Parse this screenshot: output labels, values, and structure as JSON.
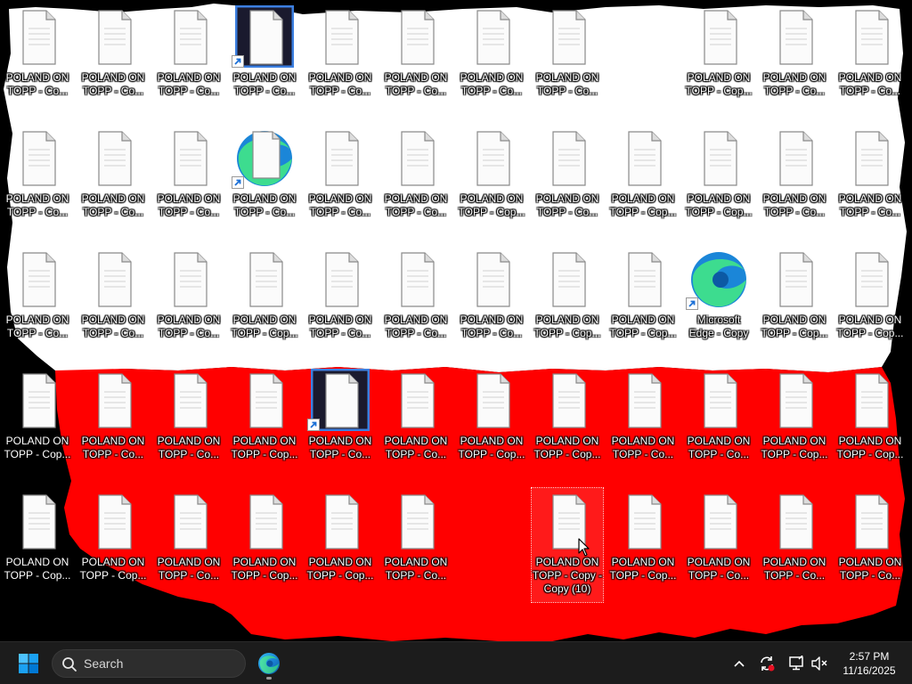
{
  "desktop": {
    "icons": [
      {
        "label": "POLAND ON TOPP - Co...",
        "kind": "file",
        "icon": "text-file-icon"
      },
      {
        "label": "POLAND ON TOPP - Co...",
        "kind": "file",
        "icon": "text-file-icon"
      },
      {
        "label": "POLAND ON TOPP - Co...",
        "kind": "file",
        "icon": "text-file-icon"
      },
      {
        "label": "POLAND ON TOPP - Co...",
        "kind": "shortcut-dark",
        "icon": "dark-file-shortcut-icon"
      },
      {
        "label": "POLAND ON TOPP - Co...",
        "kind": "file",
        "icon": "text-file-icon"
      },
      {
        "label": "POLAND ON TOPP - Co...",
        "kind": "file",
        "icon": "text-file-icon"
      },
      {
        "label": "POLAND ON TOPP - Co...",
        "kind": "file",
        "icon": "text-file-icon"
      },
      {
        "label": "POLAND ON TOPP - Co...",
        "kind": "file",
        "icon": "text-file-icon"
      },
      {
        "label": "",
        "kind": "empty",
        "icon": ""
      },
      {
        "label": "POLAND ON TOPP - Cop...",
        "kind": "file",
        "icon": "text-file-icon"
      },
      {
        "label": "POLAND ON TOPP - Co...",
        "kind": "file",
        "icon": "text-file-icon"
      },
      {
        "label": "POLAND ON TOPP - Co...",
        "kind": "file",
        "icon": "text-file-icon"
      },
      {
        "label": "POLAND ON TOPP - Co...",
        "kind": "file",
        "icon": "text-file-icon"
      },
      {
        "label": "POLAND ON TOPP - Co...",
        "kind": "file",
        "icon": "text-file-icon"
      },
      {
        "label": "POLAND ON TOPP - Co...",
        "kind": "file",
        "icon": "text-file-icon"
      },
      {
        "label": "POLAND ON TOPP - Co...",
        "kind": "shortcut-edge",
        "icon": "edge-file-shortcut-icon"
      },
      {
        "label": "POLAND ON TOPP - Co...",
        "kind": "file",
        "icon": "text-file-icon"
      },
      {
        "label": "POLAND ON TOPP - Co...",
        "kind": "file",
        "icon": "text-file-icon"
      },
      {
        "label": "POLAND ON TOPP - Cop...",
        "kind": "file",
        "icon": "text-file-icon"
      },
      {
        "label": "POLAND ON TOPP - Co...",
        "kind": "file",
        "icon": "text-file-icon"
      },
      {
        "label": "POLAND ON TOPP - Cop...",
        "kind": "file",
        "icon": "text-file-icon"
      },
      {
        "label": "POLAND ON TOPP - Cop...",
        "kind": "file",
        "icon": "text-file-icon"
      },
      {
        "label": "POLAND ON TOPP - Co...",
        "kind": "file",
        "icon": "text-file-icon"
      },
      {
        "label": "POLAND ON TOPP - Co...",
        "kind": "file",
        "icon": "text-file-icon"
      },
      {
        "label": "POLAND ON TOPP - Co...",
        "kind": "file",
        "icon": "text-file-icon"
      },
      {
        "label": "POLAND ON TOPP - Co...",
        "kind": "file",
        "icon": "text-file-icon"
      },
      {
        "label": "POLAND ON TOPP - Co...",
        "kind": "file",
        "icon": "text-file-icon"
      },
      {
        "label": "POLAND ON TOPP - Cop...",
        "kind": "file",
        "icon": "text-file-icon"
      },
      {
        "label": "POLAND ON TOPP - Co...",
        "kind": "file",
        "icon": "text-file-icon"
      },
      {
        "label": "POLAND ON TOPP - Co...",
        "kind": "file",
        "icon": "text-file-icon"
      },
      {
        "label": "POLAND ON TOPP - Co...",
        "kind": "file",
        "icon": "text-file-icon"
      },
      {
        "label": "POLAND ON TOPP - Cop...",
        "kind": "file",
        "icon": "text-file-icon"
      },
      {
        "label": "POLAND ON TOPP - Cop...",
        "kind": "file",
        "icon": "text-file-icon"
      },
      {
        "label": "Microsoft Edge - Copy",
        "kind": "edge",
        "icon": "edge-icon"
      },
      {
        "label": "POLAND ON TOPP - Cop...",
        "kind": "file",
        "icon": "text-file-icon"
      },
      {
        "label": "POLAND ON TOPP - Cop...",
        "kind": "file",
        "icon": "text-file-icon"
      },
      {
        "label": "POLAND ON TOPP - Cop...",
        "kind": "file",
        "icon": "text-file-icon"
      },
      {
        "label": "POLAND ON TOPP - Co...",
        "kind": "file",
        "icon": "text-file-icon"
      },
      {
        "label": "POLAND ON TOPP - Co...",
        "kind": "file",
        "icon": "text-file-icon"
      },
      {
        "label": "POLAND ON TOPP - Cop...",
        "kind": "file",
        "icon": "text-file-icon"
      },
      {
        "label": "POLAND ON TOPP - Co...",
        "kind": "shortcut-dark",
        "icon": "dark-file-shortcut-icon"
      },
      {
        "label": "POLAND ON TOPP - Co...",
        "kind": "file",
        "icon": "text-file-icon"
      },
      {
        "label": "POLAND ON TOPP - Cop...",
        "kind": "file",
        "icon": "text-file-icon"
      },
      {
        "label": "POLAND ON TOPP - Cop...",
        "kind": "file",
        "icon": "text-file-icon"
      },
      {
        "label": "POLAND ON TOPP - Co...",
        "kind": "file",
        "icon": "text-file-icon"
      },
      {
        "label": "POLAND ON TOPP - Co...",
        "kind": "file",
        "icon": "text-file-icon"
      },
      {
        "label": "POLAND ON TOPP - Cop...",
        "kind": "file",
        "icon": "text-file-icon"
      },
      {
        "label": "POLAND ON TOPP - Cop...",
        "kind": "file",
        "icon": "text-file-icon"
      },
      {
        "label": "POLAND ON TOPP - Cop...",
        "kind": "file",
        "icon": "text-file-icon"
      },
      {
        "label": "POLAND ON TOPP - Cop...",
        "kind": "file",
        "icon": "text-file-icon"
      },
      {
        "label": "POLAND ON TOPP - Co...",
        "kind": "file",
        "icon": "text-file-icon"
      },
      {
        "label": "POLAND ON TOPP - Cop...",
        "kind": "file",
        "icon": "text-file-icon"
      },
      {
        "label": "POLAND ON TOPP - Cop...",
        "kind": "file",
        "icon": "text-file-icon"
      },
      {
        "label": "POLAND ON TOPP - Co...",
        "kind": "file",
        "icon": "text-file-icon"
      },
      {
        "label": "",
        "kind": "empty",
        "icon": ""
      },
      {
        "label": "POLAND ON TOPP - Copy - Copy (10)",
        "kind": "file",
        "icon": "text-file-icon",
        "selected": true
      },
      {
        "label": "POLAND ON TOPP - Cop...",
        "kind": "file",
        "icon": "text-file-icon"
      },
      {
        "label": "POLAND ON TOPP - Co...",
        "kind": "file",
        "icon": "text-file-icon"
      },
      {
        "label": "POLAND ON TOPP - Co...",
        "kind": "file",
        "icon": "text-file-icon"
      },
      {
        "label": "POLAND ON TOPP - Co...",
        "kind": "file",
        "icon": "text-file-icon"
      }
    ]
  },
  "taskbar": {
    "start_icon": "windows-logo-icon",
    "search_placeholder": "Search",
    "pinned": [
      {
        "name": "Microsoft Edge",
        "icon": "edge-icon",
        "running": true
      }
    ],
    "tray": [
      {
        "name": "show-hidden-icons",
        "icon": "chevron-up-icon"
      },
      {
        "name": "sync",
        "icon": "sync-icon"
      },
      {
        "name": "network",
        "icon": "network-icon"
      },
      {
        "name": "volume",
        "icon": "volume-muted-icon"
      }
    ],
    "clock": {
      "time": "2:57 PM",
      "date": "11/16/2025"
    }
  },
  "colors": {
    "flag_white": "#ffffff",
    "flag_red": "#ff0000",
    "background": "#000000",
    "taskbar": "#1c1c1c",
    "accent": "#0078d4"
  }
}
